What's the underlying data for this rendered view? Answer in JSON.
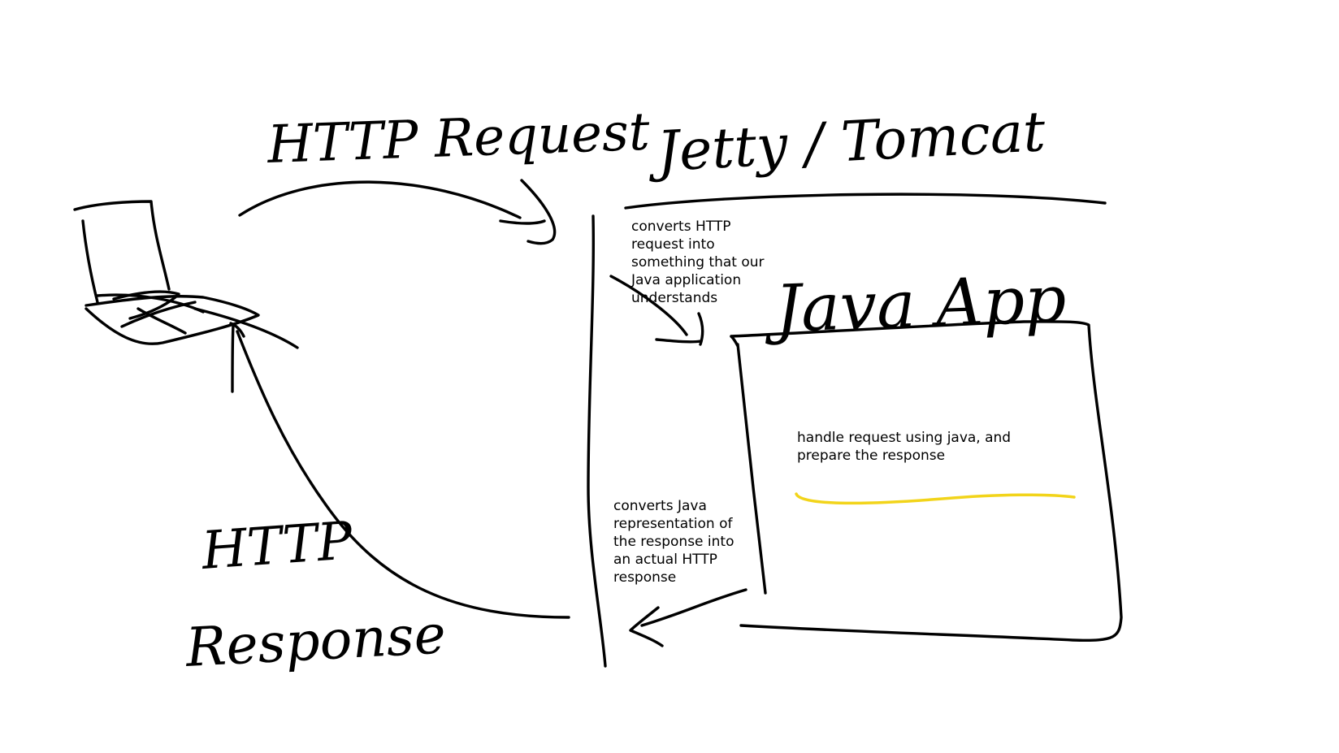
{
  "labels": {
    "http_request": "HTTP Request",
    "server": "Jetty / Tomcat",
    "java_app": "Java App",
    "http_response_line1": "HTTP",
    "http_response_line2": "Response"
  },
  "notes": {
    "converts_request": "converts HTTP\nrequest into\nsomething that our\nJava application\nunderstands",
    "converts_response": "converts Java\nrepresentation of\nthe response into\nan actual HTTP\nresponse",
    "handle_request": "handle request using java, and\nprepare the response"
  },
  "colors": {
    "ink": "#000000",
    "highlight": "#f2d41a",
    "background": "#ffffff"
  },
  "icons": {
    "client": "laptop-icon"
  }
}
